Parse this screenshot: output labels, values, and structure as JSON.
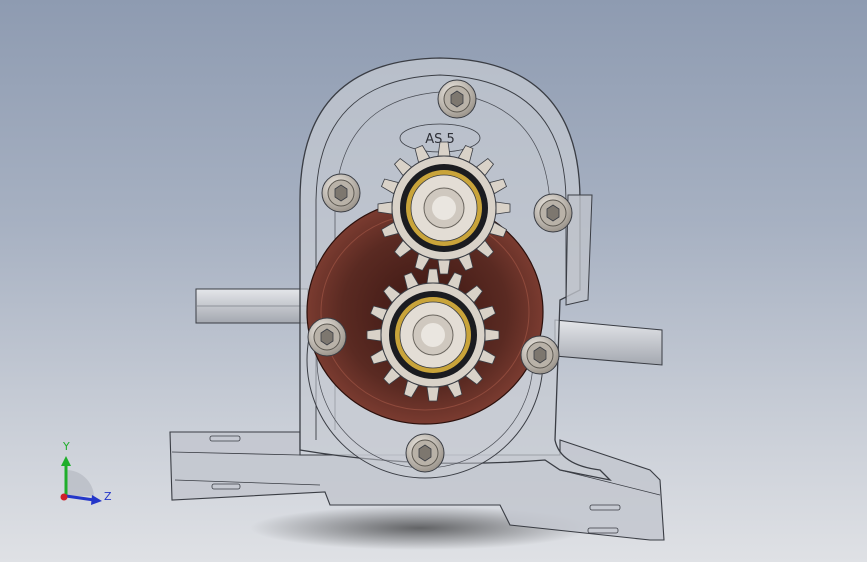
{
  "viewport": {
    "background_top": "#8e9bb1",
    "background_bottom": "#dfe1e5"
  },
  "model": {
    "housing_color": "#c8ccd3",
    "housing_edge_color": "#3a3d44",
    "inner_cavity_color": "#5a2a22",
    "gear_color": "#d9d2c8",
    "bearing_accent_color": "#c9a43a",
    "bolt_color": "#cfcac3",
    "engraved_text": "AS 5",
    "components": [
      "housing",
      "upper-gear",
      "lower-gear",
      "input-shaft",
      "output-shaft",
      "base-plate",
      "bolts"
    ]
  },
  "triad": {
    "y_label": "Y",
    "z_label": "Z",
    "y_color": "#1fae2b",
    "z_color": "#2436c9",
    "x_color": "#d0202a"
  }
}
